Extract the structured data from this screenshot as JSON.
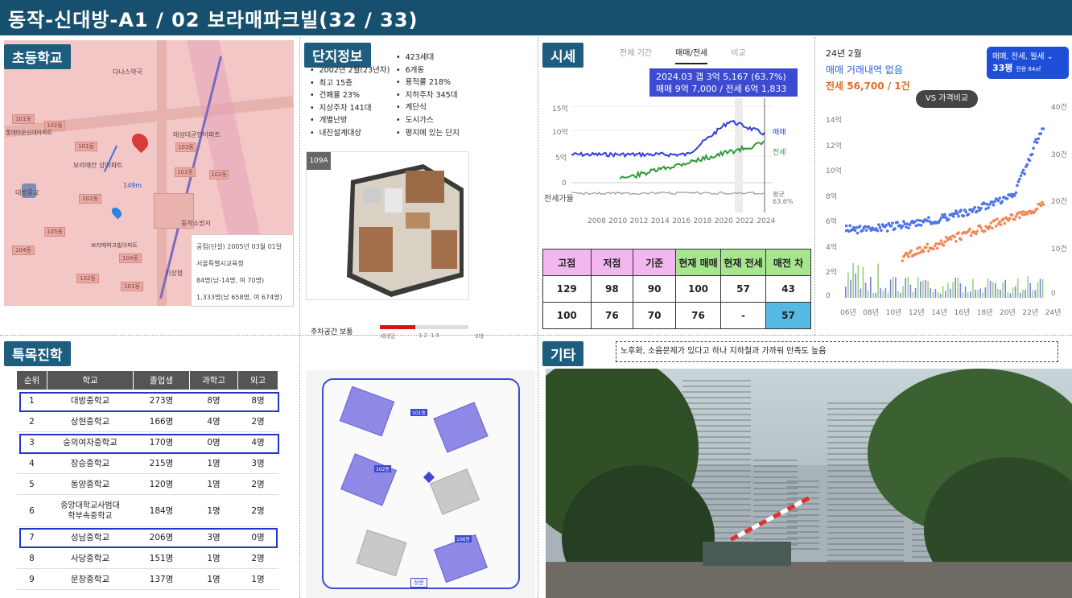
{
  "header": {
    "title": "동작-신대방-A1 / 02 보라매파크빌(32 / 33)"
  },
  "sections": {
    "elementary": "초등학교",
    "complex": "단지정보",
    "price": "시세",
    "special": "특목진학",
    "etc": "기타"
  },
  "school_map": {
    "labels": [
      "다나스약국",
      "태성대균인아파트",
      "보라매칸 상아파트",
      "대방중교",
      "동작소방서",
      "보라매파크빌아파트",
      "기상청",
      "대방초등학교",
      "롯데타운신대아파트"
    ],
    "distance": "149m",
    "info": [
      "공립(단설) 2005년 03월 01일",
      "서울특별시교육청",
      "84명(남-14명, 여 70명)",
      "1,333명(남 658명, 여 674명)"
    ]
  },
  "complex_info": {
    "left": [
      "2002년 2월(23년차)",
      "최고 15층",
      "건폐율 23%",
      "지상주차 141대",
      "개별난방",
      "내진설계대상"
    ],
    "right": [
      "423세대",
      "6개동",
      "용적률 218%",
      "지하주차 345대",
      "계단식",
      "도시가스",
      "평지에 있는 단지"
    ],
    "plan_label": "109A",
    "parking_label": "주차공간 보통",
    "parking_scale": [
      "세대당",
      "1.2",
      "1.5",
      "3대"
    ],
    "parking_value": 1.21
  },
  "price_chart": {
    "tabs": [
      "전체 기간",
      "매매/전세",
      "비교"
    ],
    "tooltip_line1": "2024.03  갭 3억 5,167 (63.7%)",
    "tooltip_line2": "매매 9억 7,000 / 전세 6억 1,833",
    "y_labels": [
      "15억",
      "10억",
      "5억",
      "0"
    ],
    "x_labels": [
      "2008",
      "2010",
      "2012",
      "2014",
      "2016",
      "2018",
      "2020",
      "2022",
      "2024"
    ],
    "legend_sale": "매매",
    "legend_jeonse": "전세",
    "ratio_label": "전세가율",
    "ratio_avg": "평균",
    "ratio_value": "63.6%"
  },
  "price_table": {
    "headers": [
      "고점",
      "저점",
      "기준",
      "현재 매매",
      "현재 전세",
      "매전 차"
    ],
    "row1": [
      "129",
      "98",
      "90",
      "100",
      "57",
      "43"
    ],
    "row2": [
      "100",
      "76",
      "70",
      "76",
      "-",
      "57"
    ]
  },
  "trade_chart": {
    "month": "24년 2월",
    "sale_line": "매매 거래내역 없음",
    "jeonse_line": "전세 56,700 / 1건",
    "filter": "매매, 전세, 월세",
    "size": "33평",
    "size_sub": "전용 84㎡",
    "compare": "VS 가격비교",
    "y_left": [
      "14억",
      "12억",
      "10억",
      "8억",
      "6억",
      "4억",
      "2억",
      "0"
    ],
    "y_right": [
      "40건",
      "30건",
      "20건",
      "10건",
      "0"
    ],
    "x_labels": [
      "06년",
      "08년",
      "10년",
      "12년",
      "14년",
      "16년",
      "18년",
      "20년",
      "22년",
      "24년"
    ]
  },
  "school_table": {
    "headers": [
      "순위",
      "학교",
      "졸업생",
      "과학고",
      "외고"
    ],
    "rows": [
      [
        "1",
        "대방중학교",
        "273명",
        "8명",
        "8명"
      ],
      [
        "2",
        "상현중학교",
        "166명",
        "4명",
        "2명"
      ],
      [
        "3",
        "숭의여자중학교",
        "170명",
        "0명",
        "4명"
      ],
      [
        "4",
        "장승중학교",
        "215명",
        "1명",
        "3명"
      ],
      [
        "5",
        "동양중학교",
        "120명",
        "1명",
        "2명"
      ],
      [
        "6",
        "중앙대학교사범대 학부속중학교",
        "184명",
        "1명",
        "2명"
      ],
      [
        "7",
        "성남중학교",
        "206명",
        "3명",
        "0명"
      ],
      [
        "8",
        "사당중학교",
        "151명",
        "1명",
        "2명"
      ],
      [
        "9",
        "문창중학교",
        "137명",
        "1명",
        "1명"
      ]
    ]
  },
  "etc": {
    "note": "노후화, 소음문제가 있다고 하나 지하철과 가까워 만족도 높음"
  },
  "complex_map": {
    "buildings": [
      "101동",
      "102동",
      "103동",
      "104동",
      "105동",
      "106동"
    ],
    "unit": "109타입",
    "gate": "정문"
  },
  "colors": {
    "header": "#17506e",
    "tag": "#1f5d7e",
    "sale": "#3340d6",
    "jeonse": "#2f9a3a",
    "pink": "#f2b7ef",
    "green": "#a7e58e",
    "blue": "#56b9e4"
  }
}
